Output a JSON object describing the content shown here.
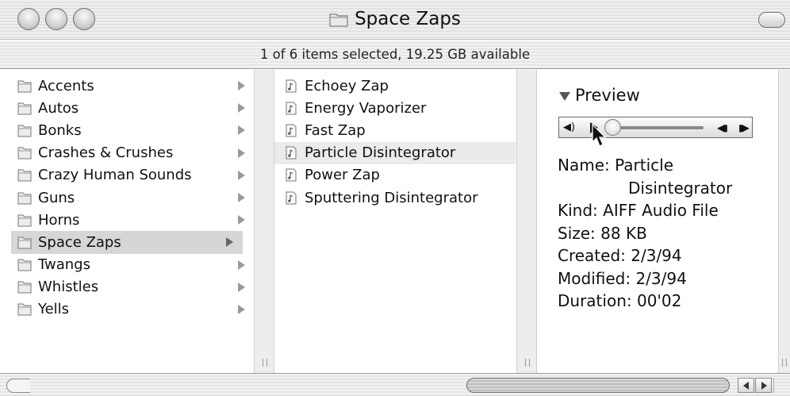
{
  "window": {
    "title": "Space Zaps"
  },
  "status": {
    "text": "1 of 6 items selected, 19.25 GB available"
  },
  "column1": {
    "items": [
      {
        "label": "Accents",
        "selected": false
      },
      {
        "label": "Autos",
        "selected": false
      },
      {
        "label": "Bonks",
        "selected": false
      },
      {
        "label": "Crashes & Crushes",
        "selected": false
      },
      {
        "label": "Crazy Human Sounds",
        "selected": false
      },
      {
        "label": "Guns",
        "selected": false
      },
      {
        "label": "Horns",
        "selected": false
      },
      {
        "label": "Space Zaps",
        "selected": true
      },
      {
        "label": "Twangs",
        "selected": false
      },
      {
        "label": "Whistles",
        "selected": false
      },
      {
        "label": "Yells",
        "selected": false
      }
    ]
  },
  "column2": {
    "items": [
      {
        "label": "Echoey Zap",
        "selected": false
      },
      {
        "label": "Energy Vaporizer",
        "selected": false
      },
      {
        "label": "Fast Zap",
        "selected": false
      },
      {
        "label": "Particle Disintegrator",
        "selected": true
      },
      {
        "label": "Power Zap",
        "selected": false
      },
      {
        "label": "Sputtering Disintegrator",
        "selected": false
      }
    ]
  },
  "preview": {
    "heading": "Preview",
    "name_label": "Name:",
    "name_line1": "Particle",
    "name_line2": "Disintegrator",
    "kind_label": "Kind:",
    "kind_value": "AIFF Audio File",
    "size_label": "Size:",
    "size_value": "88 KB",
    "created_label": "Created:",
    "created_value": "2/3/94",
    "modified_label": "Modified:",
    "modified_value": "2/3/94",
    "duration_label": "Duration:",
    "duration_value": "00'02",
    "playback_position": 0
  },
  "icons": {
    "folder": "folder-icon",
    "audio_file": "audio-file-icon",
    "disclosure": "disclosure-triangle-icon"
  }
}
